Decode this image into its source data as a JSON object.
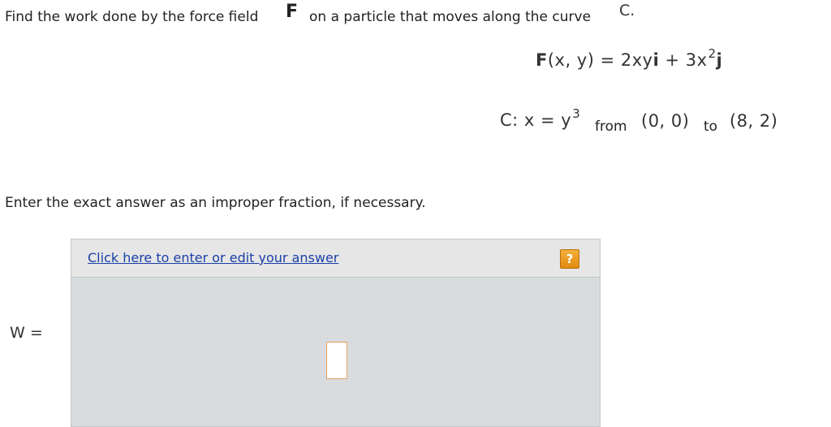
{
  "question": {
    "prefix": "Find the work done by the force field",
    "field_symbol": "F",
    "middle": "on a particle that moves along the curve",
    "curve_symbol": "C."
  },
  "force": {
    "lhs_bold": "F",
    "lhs_rest": "(x, y) = 2xy",
    "i_unit": "i",
    "plus": " + 3x",
    "exp": "2",
    "j_unit": "j"
  },
  "curve": {
    "lhs": "C: x = y",
    "exp": "3",
    "from_word": "from",
    "start_point": "(0, 0)",
    "to_word": "to",
    "end_point": "(8, 2)"
  },
  "instruction": "Enter the exact answer as an improper fraction, if necessary.",
  "answer": {
    "variable_label": "W =",
    "edit_link": "Click here to enter or edit your answer",
    "help_symbol": "?"
  }
}
